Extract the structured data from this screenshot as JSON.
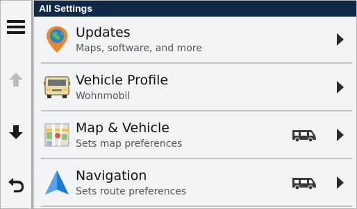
{
  "header": {
    "title": "All Settings"
  },
  "rail": {
    "menu_icon": "hamburger-menu-icon",
    "up_icon": "arrow-up-icon",
    "down_icon": "arrow-down-icon",
    "back_icon": "back-arrow-icon"
  },
  "items": [
    {
      "title": "Updates",
      "subtitle": "Maps, software, and more",
      "icon": "globe-pin-icon",
      "rv_badge": false
    },
    {
      "title": "Vehicle Profile",
      "subtitle": "Wohnmobil",
      "icon": "camper-front-icon",
      "rv_badge": false
    },
    {
      "title": "Map & Vehicle",
      "subtitle": "Sets map preferences",
      "icon": "map-icon",
      "rv_badge": true
    },
    {
      "title": "Navigation",
      "subtitle": "Sets route preferences",
      "icon": "navigation-arrow-icon",
      "rv_badge": true
    }
  ],
  "colors": {
    "header_bg": "#0f2a48",
    "accent_blue": "#1e7ad6"
  }
}
